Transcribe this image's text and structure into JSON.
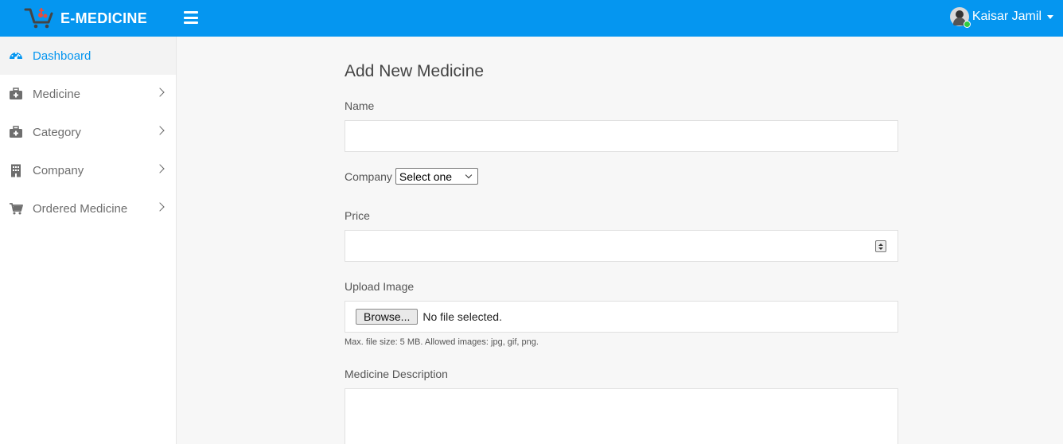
{
  "topbar": {
    "brand": "E-MEDICINE",
    "user_name": "Kaisar Jamil",
    "colors": {
      "primary": "#0596f0",
      "status_online": "#2ecc40"
    }
  },
  "sidebar": {
    "items": [
      {
        "label": "Dashboard",
        "icon": "dashboard-gauge-icon",
        "active": true
      },
      {
        "label": "Medicine",
        "icon": "medical-bag-icon"
      },
      {
        "label": "Category",
        "icon": "medical-bag-icon"
      },
      {
        "label": "Company",
        "icon": "building-icon"
      },
      {
        "label": "Ordered Medicine",
        "icon": "cart-icon"
      }
    ]
  },
  "form": {
    "title": "Add New Medicine",
    "name_label": "Name",
    "name_value": "",
    "company_label": "Company",
    "company_selected": "Select one",
    "price_label": "Price",
    "price_value": "",
    "upload_label": "Upload Image",
    "browse_label": "Browse...",
    "file_status": "No file selected.",
    "upload_help": "Max. file size: 5 MB. Allowed images: jpg, gif, png.",
    "description_label": "Medicine Description",
    "description_value": ""
  }
}
